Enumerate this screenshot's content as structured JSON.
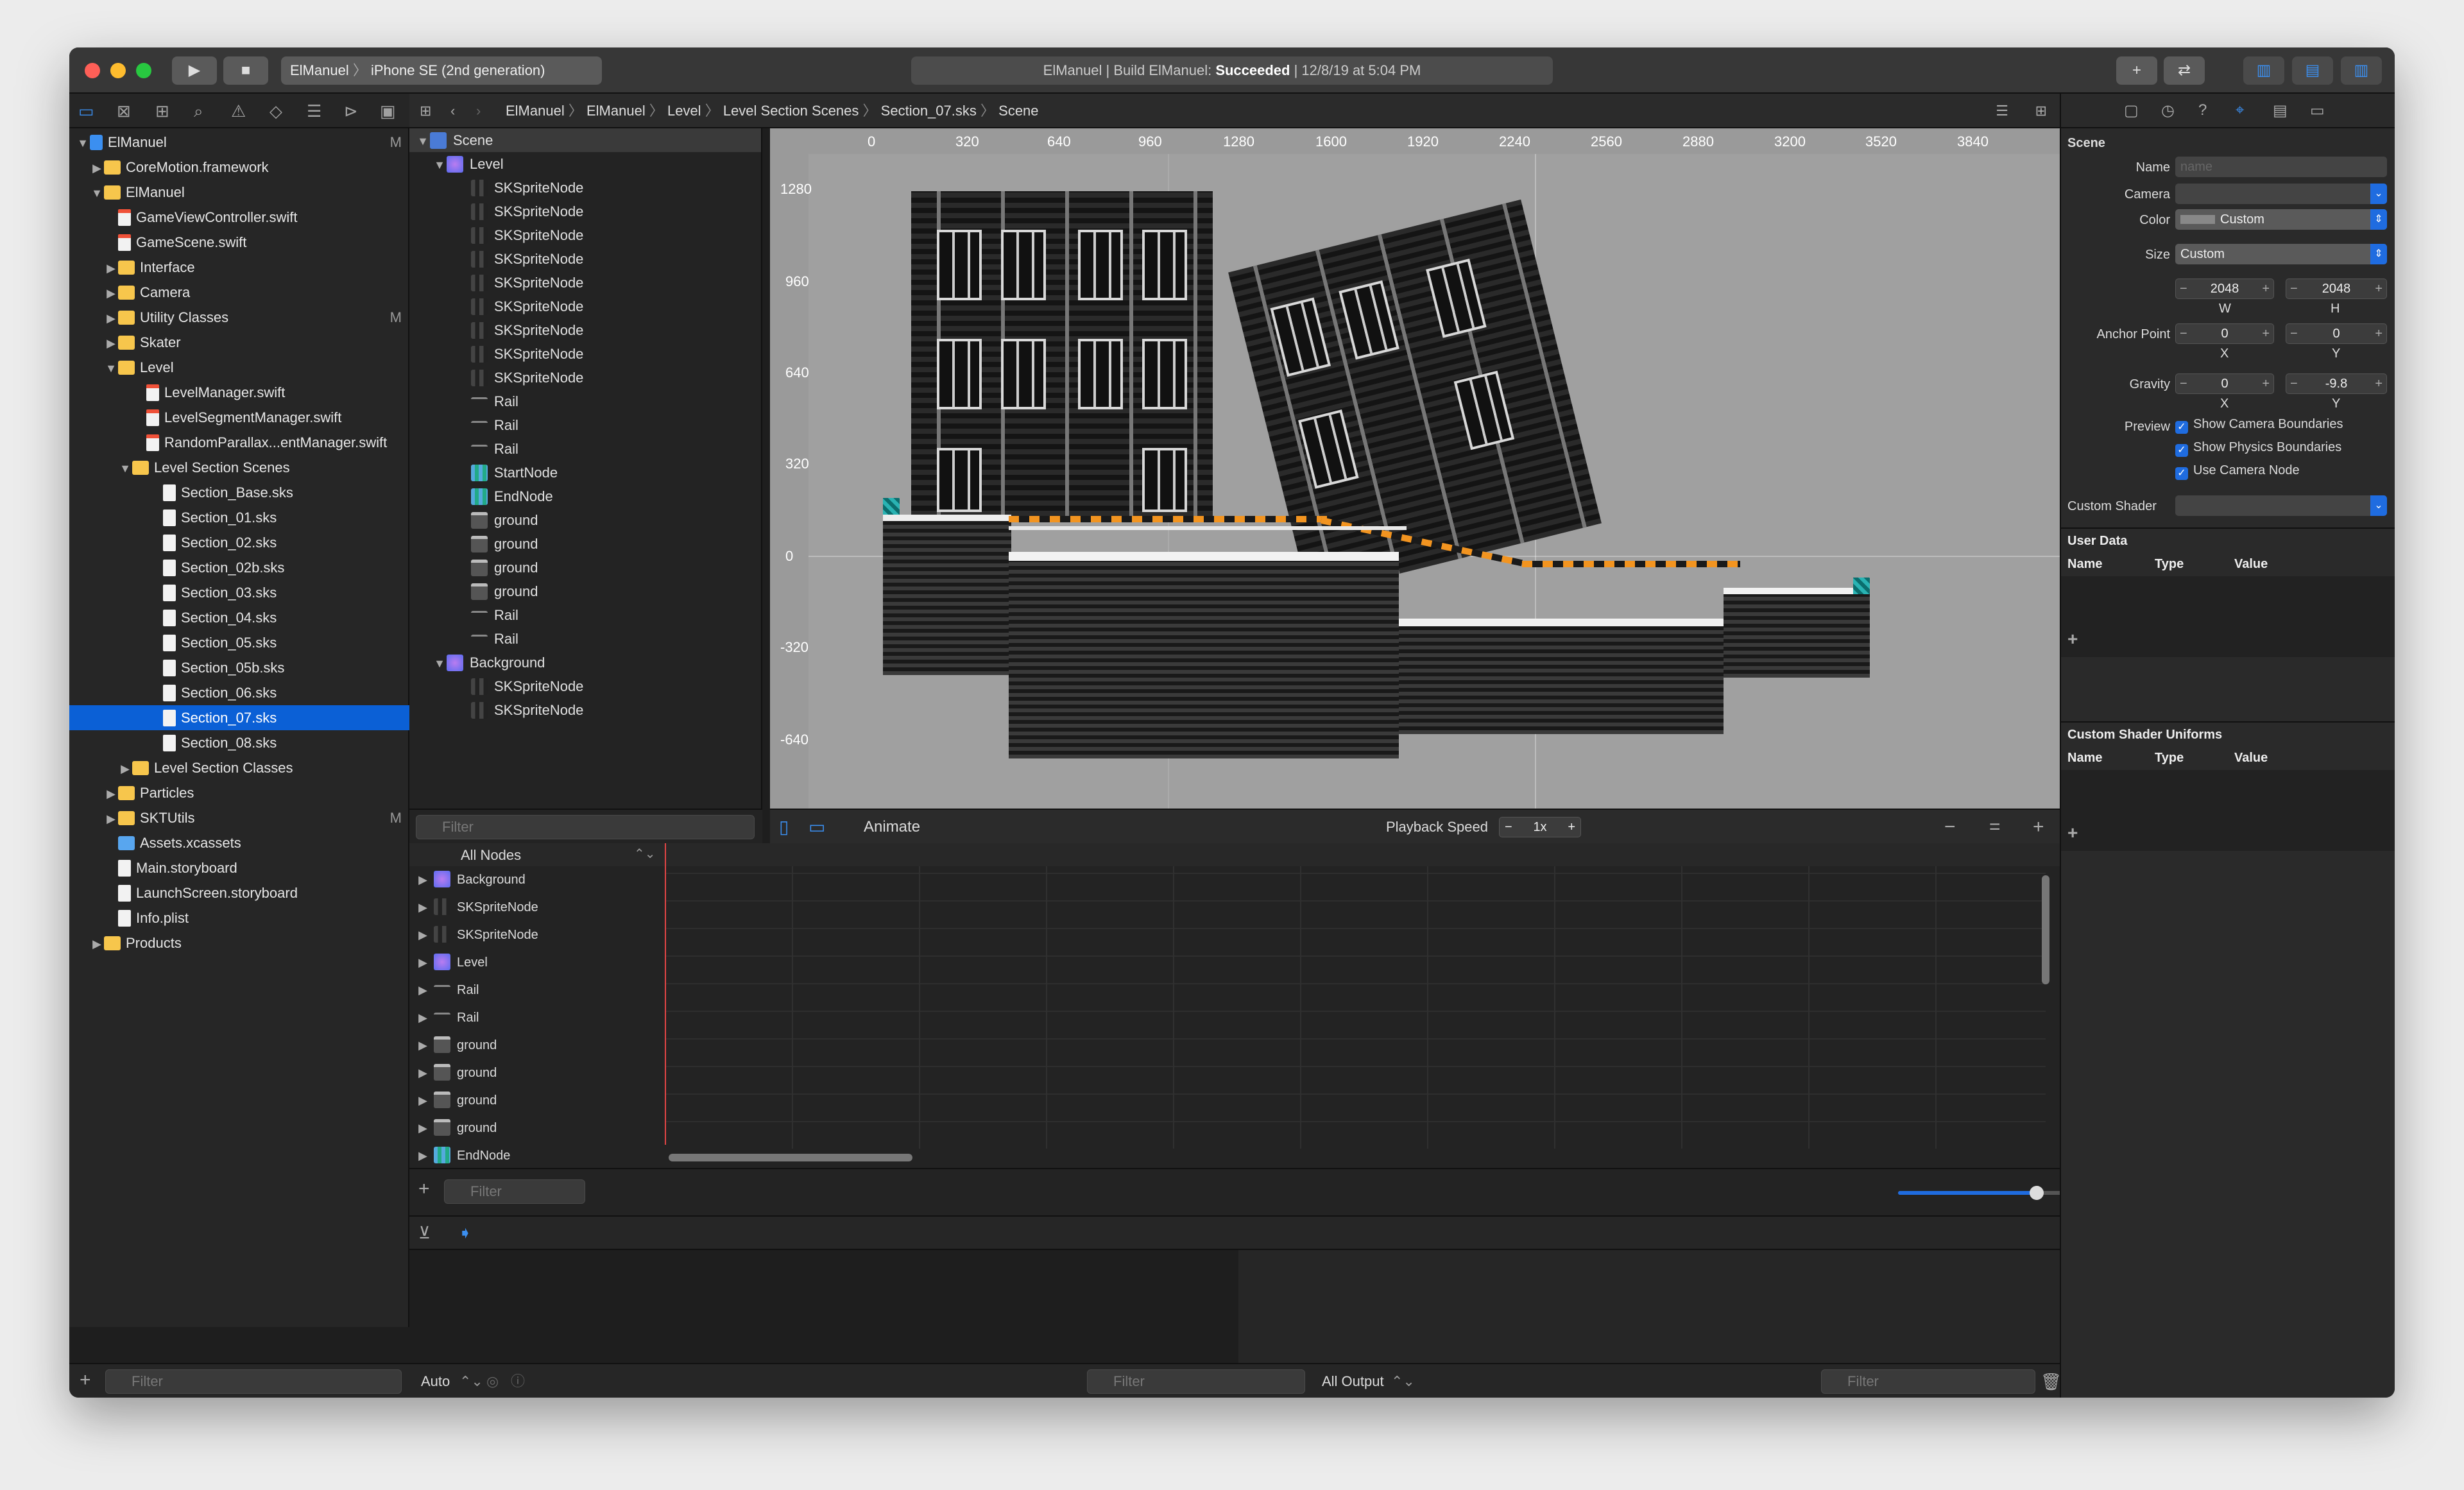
{
  "toolbar": {
    "scheme_target": "ElManuel",
    "scheme_device": "iPhone SE (2nd generation)",
    "activity_prefix": "ElManuel | Build ElManuel: ",
    "activity_status": "Succeeded",
    "activity_time": " | 12/8/19 at 5:04 PM"
  },
  "navigator": {
    "items": [
      {
        "label": "ElManuel",
        "badge": "M"
      },
      {
        "label": "CoreMotion.framework",
        "badge": ""
      },
      {
        "label": "ElManuel",
        "badge": ""
      },
      {
        "label": "GameViewController.swift",
        "badge": ""
      },
      {
        "label": "GameScene.swift",
        "badge": ""
      },
      {
        "label": "Interface",
        "badge": ""
      },
      {
        "label": "Camera",
        "badge": ""
      },
      {
        "label": "Utility Classes",
        "badge": "M"
      },
      {
        "label": "Skater",
        "badge": ""
      },
      {
        "label": "Level",
        "badge": ""
      },
      {
        "label": "LevelManager.swift",
        "badge": ""
      },
      {
        "label": "LevelSegmentManager.swift",
        "badge": ""
      },
      {
        "label": "RandomParallax...entManager.swift",
        "badge": ""
      },
      {
        "label": "Level Section Scenes",
        "badge": ""
      },
      {
        "label": "Section_Base.sks",
        "badge": ""
      },
      {
        "label": "Section_01.sks",
        "badge": ""
      },
      {
        "label": "Section_02.sks",
        "badge": ""
      },
      {
        "label": "Section_02b.sks",
        "badge": ""
      },
      {
        "label": "Section_03.sks",
        "badge": ""
      },
      {
        "label": "Section_04.sks",
        "badge": ""
      },
      {
        "label": "Section_05.sks",
        "badge": ""
      },
      {
        "label": "Section_05b.sks",
        "badge": ""
      },
      {
        "label": "Section_06.sks",
        "badge": ""
      },
      {
        "label": "Section_07.sks",
        "badge": ""
      },
      {
        "label": "Section_08.sks",
        "badge": ""
      },
      {
        "label": "Level Section Classes",
        "badge": ""
      },
      {
        "label": "Particles",
        "badge": ""
      },
      {
        "label": "SKTUtils",
        "badge": "M"
      },
      {
        "label": "Assets.xcassets",
        "badge": ""
      },
      {
        "label": "Main.storyboard",
        "badge": ""
      },
      {
        "label": "LaunchScreen.storyboard",
        "badge": ""
      },
      {
        "label": "Info.plist",
        "badge": ""
      },
      {
        "label": "Products",
        "badge": ""
      }
    ],
    "filter_placeholder": "Filter"
  },
  "jumpbar": [
    "ElManuel",
    "ElManuel",
    "Level",
    "Level Section Scenes",
    "Section_07.sks",
    "Scene"
  ],
  "outline": {
    "items": [
      "Scene",
      "Level",
      "SKSpriteNode",
      "SKSpriteNode",
      "SKSpriteNode",
      "SKSpriteNode",
      "SKSpriteNode",
      "SKSpriteNode",
      "SKSpriteNode",
      "SKSpriteNode",
      "SKSpriteNode",
      "Rail",
      "Rail",
      "Rail",
      "StartNode",
      "EndNode",
      "ground",
      "ground",
      "ground",
      "ground",
      "Rail",
      "Rail",
      "Background",
      "SKSpriteNode",
      "SKSpriteNode"
    ],
    "filter_placeholder": "Filter"
  },
  "ruler": {
    "x_ticks": [
      "0",
      "320",
      "640",
      "960",
      "1280",
      "1600",
      "1920",
      "2240",
      "2560",
      "2880",
      "3200",
      "3520",
      "3840"
    ],
    "y_ticks": [
      "1280",
      "960",
      "640",
      "320",
      "0",
      "-320",
      "-640"
    ]
  },
  "scene_bar": {
    "animate": "Animate",
    "playback_label": "Playback Speed",
    "speed_minus": "−",
    "speed_value": "1x",
    "speed_plus": "+"
  },
  "timeline": {
    "selector": "All Nodes",
    "rows": [
      "Background",
      "SKSpriteNode",
      "SKSpriteNode",
      "Level",
      "Rail",
      "Rail",
      "ground",
      "ground",
      "ground",
      "ground",
      "EndNode"
    ],
    "filter_placeholder": "Filter",
    "zoom_level": 0.8
  },
  "debug": {
    "auto_label": "Auto",
    "vars_filter": "Filter",
    "output_label": "All Output",
    "console_filter": "Filter"
  },
  "inspector": {
    "section_scene": "Scene",
    "name_label": "Name",
    "name_placeholder": "name",
    "camera_label": "Camera",
    "color_label": "Color",
    "color_value": "Custom",
    "size_label": "Size",
    "size_value": "Custom",
    "width": "2048",
    "height": "2048",
    "w_label": "W",
    "h_label": "H",
    "anchor_label": "Anchor Point",
    "anchor_x": "0",
    "anchor_y": "0",
    "x_label": "X",
    "y_label": "Y",
    "gravity_label": "Gravity",
    "gravity_x": "0",
    "gravity_y": "-9.8",
    "preview_label": "Preview",
    "opt_camera_bounds": "Show Camera Boundaries",
    "opt_physics_bounds": "Show Physics Boundaries",
    "opt_camera_node": "Use Camera Node",
    "shader_label": "Custom Shader",
    "user_data": "User Data",
    "uniforms": "Custom Shader Uniforms",
    "col_name": "Name",
    "col_type": "Type",
    "col_value": "Value"
  },
  "colors": {
    "accent": "#0b60d6",
    "hazard": "#f29420",
    "playhead": "#e04545"
  }
}
